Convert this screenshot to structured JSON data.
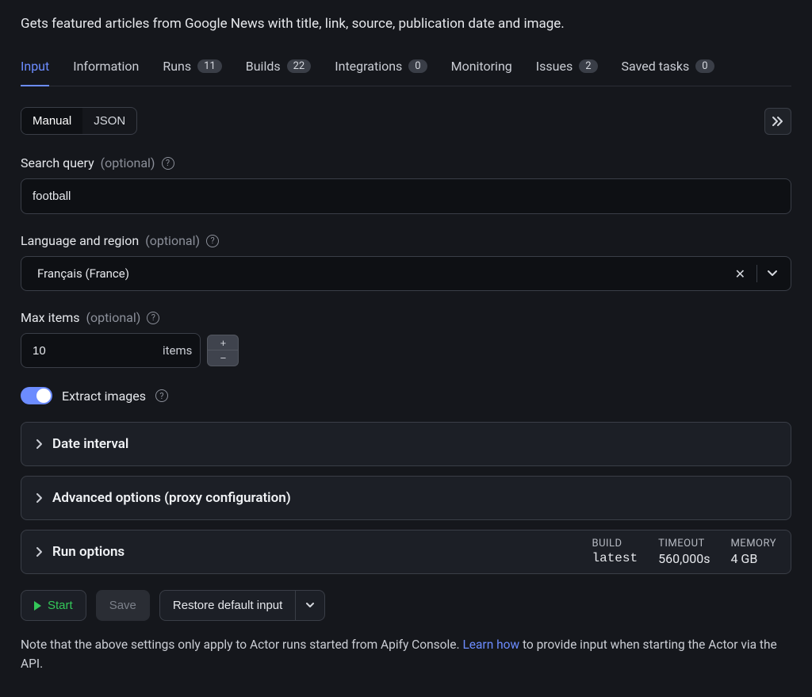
{
  "description": "Gets featured articles from Google News with title, link, source, publication date and image.",
  "tabs": [
    {
      "label": "Input",
      "badge": null,
      "active": true
    },
    {
      "label": "Information",
      "badge": null
    },
    {
      "label": "Runs",
      "badge": "11"
    },
    {
      "label": "Builds",
      "badge": "22"
    },
    {
      "label": "Integrations",
      "badge": "0"
    },
    {
      "label": "Monitoring",
      "badge": null
    },
    {
      "label": "Issues",
      "badge": "2"
    },
    {
      "label": "Saved tasks",
      "badge": "0"
    }
  ],
  "mode": {
    "manual": "Manual",
    "json": "JSON"
  },
  "fields": {
    "search": {
      "label": "Search query",
      "opt": "(optional)",
      "value": "football"
    },
    "lang": {
      "label": "Language and region",
      "opt": "(optional)",
      "value": "Français (France)"
    },
    "max": {
      "label": "Max items",
      "opt": "(optional)",
      "value": "10",
      "unit": "items"
    },
    "extract": {
      "label": "Extract images"
    }
  },
  "accordions": {
    "date": "Date interval",
    "advanced": "Advanced options (proxy configuration)",
    "run": "Run options"
  },
  "run_stats": {
    "build_label": "BUILD",
    "build_value": "latest",
    "timeout_label": "TIMEOUT",
    "timeout_value": "560,000s",
    "memory_label": "MEMORY",
    "memory_value": "4 GB"
  },
  "actions": {
    "start": "Start",
    "save": "Save",
    "restore": "Restore default input"
  },
  "footnote": {
    "pre": "Note that the above settings only apply to Actor runs started from Apify Console. ",
    "link": "Learn how",
    "post": " to provide input when starting the Actor via the API."
  }
}
